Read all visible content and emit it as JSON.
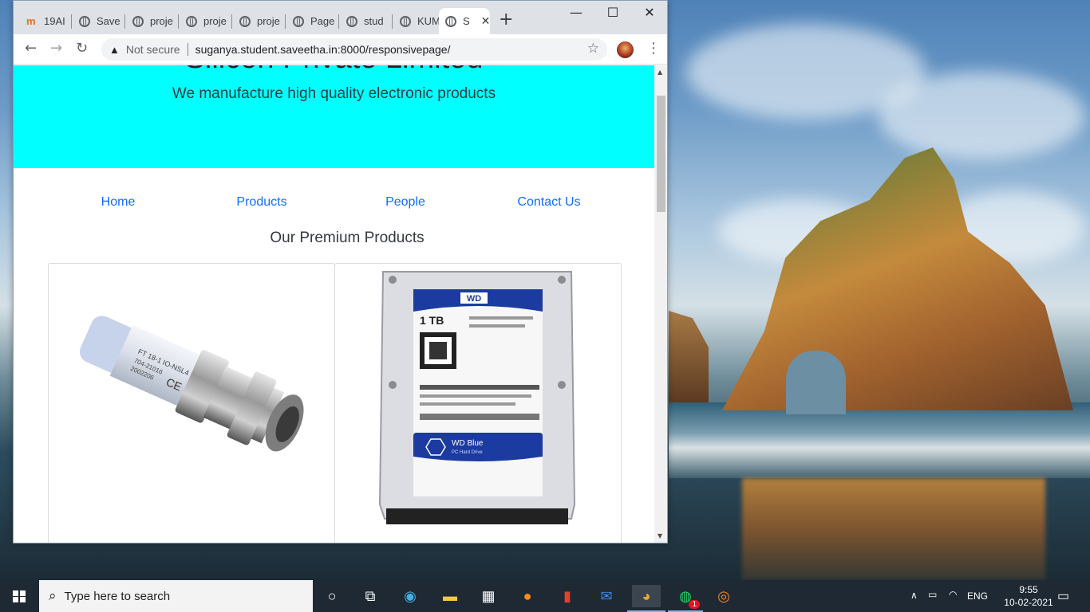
{
  "browser": {
    "tabs": [
      {
        "label": "19AI",
        "icon": "moodle-icon"
      },
      {
        "label": "Save",
        "icon": "globe-icon"
      },
      {
        "label": "proje",
        "icon": "globe-icon"
      },
      {
        "label": "proje",
        "icon": "globe-icon"
      },
      {
        "label": "proje",
        "icon": "globe-icon"
      },
      {
        "label": "Page",
        "icon": "globe-icon"
      },
      {
        "label": "stud",
        "icon": "globe-icon"
      },
      {
        "label": "KUM",
        "icon": "globe-icon"
      },
      {
        "label": "S",
        "icon": "globe-icon"
      }
    ],
    "new_tab": "+",
    "security_text": "Not secure",
    "url": "suganya.student.saveetha.in:8000/responsivepage/"
  },
  "page": {
    "hero_title": "Silicon Private Limited",
    "hero_subtitle": "We manufacture high quality electronic products",
    "nav": [
      "Home",
      "Products",
      "People",
      "Contact Us"
    ],
    "section_title": "Our Premium Products",
    "products": {
      "sensor_label": "FT 18-1 IO-NSL4",
      "sensor_code1": "704-21016",
      "sensor_code2": "2002206",
      "hdd_brand": "WD",
      "hdd_capacity": "1 TB",
      "hdd_series": "WD Blue",
      "hdd_sub": "PC Hard Drive"
    }
  },
  "taskbar": {
    "search_placeholder": "Type here to search",
    "language": "ENG",
    "time": "9:55",
    "date": "10-02-2021",
    "whatsapp_badge": "1"
  }
}
